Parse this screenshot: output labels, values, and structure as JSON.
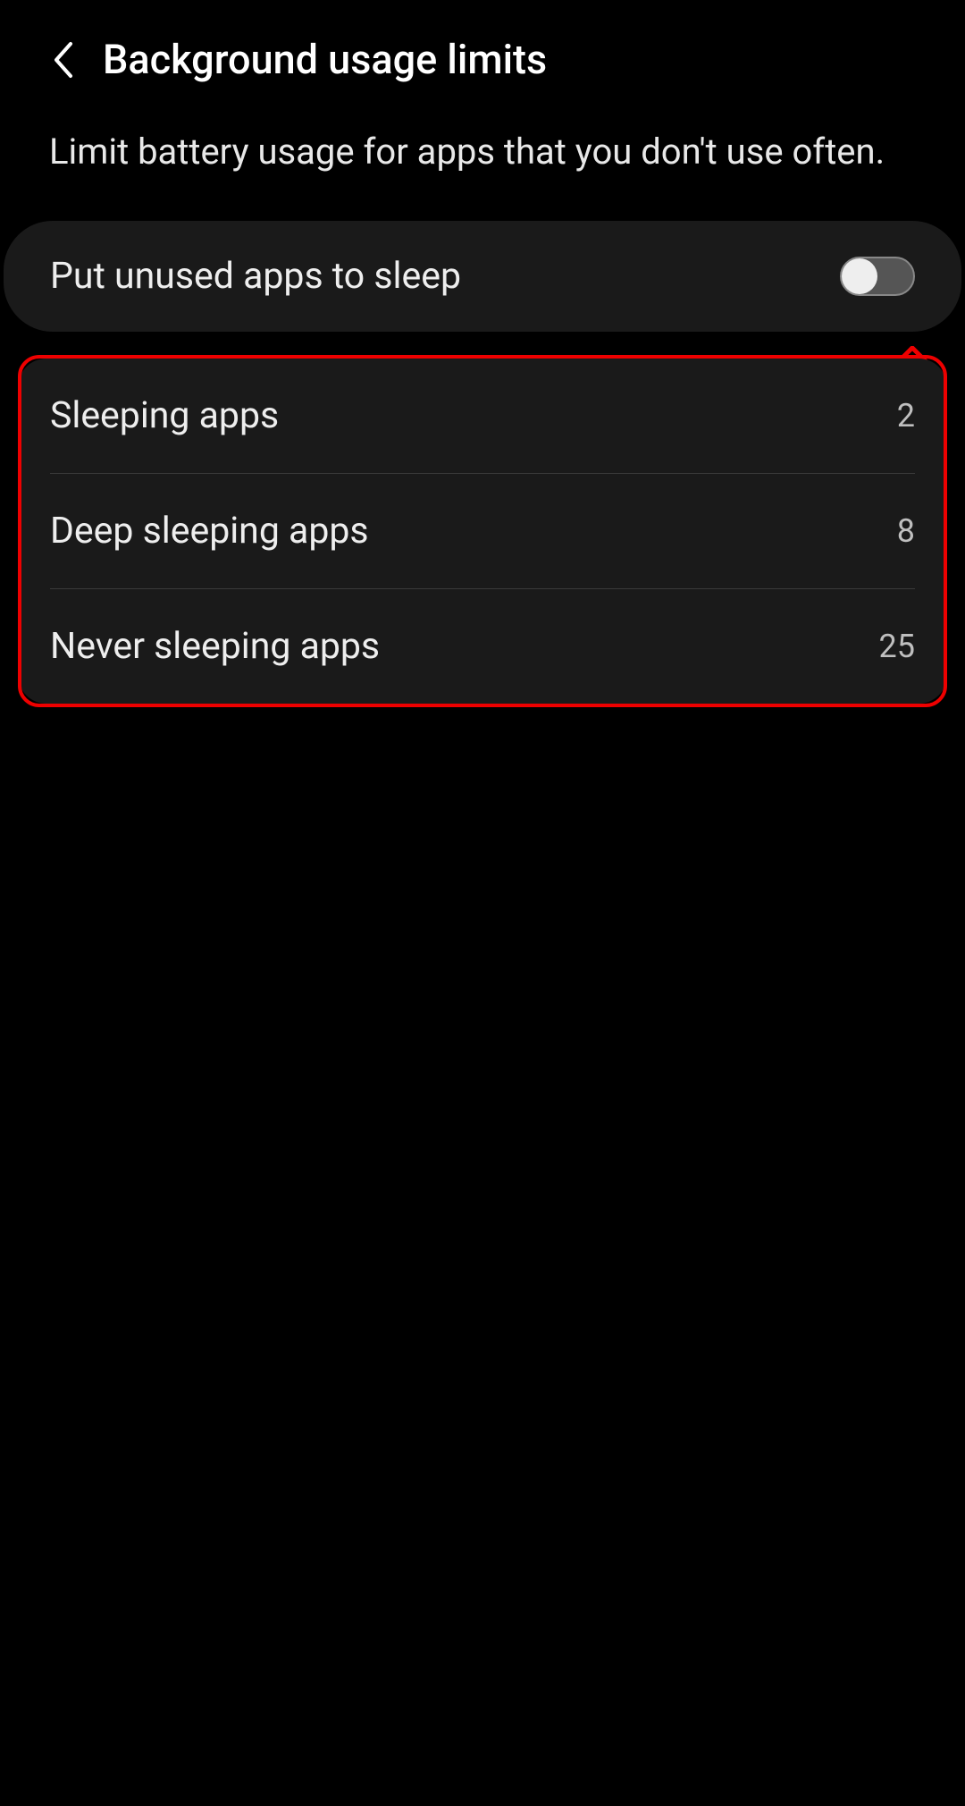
{
  "header": {
    "title": "Background usage limits"
  },
  "description": "Limit battery usage for apps that you don't use often.",
  "toggle": {
    "label": "Put unused apps to sleep",
    "state": "off"
  },
  "items": [
    {
      "label": "Sleeping apps",
      "count": "2"
    },
    {
      "label": "Deep sleeping apps",
      "count": "8"
    },
    {
      "label": "Never sleeping apps",
      "count": "25"
    }
  ],
  "annotations": {
    "arrow_color": "#ee0000",
    "highlight_color": "#ee0000"
  }
}
